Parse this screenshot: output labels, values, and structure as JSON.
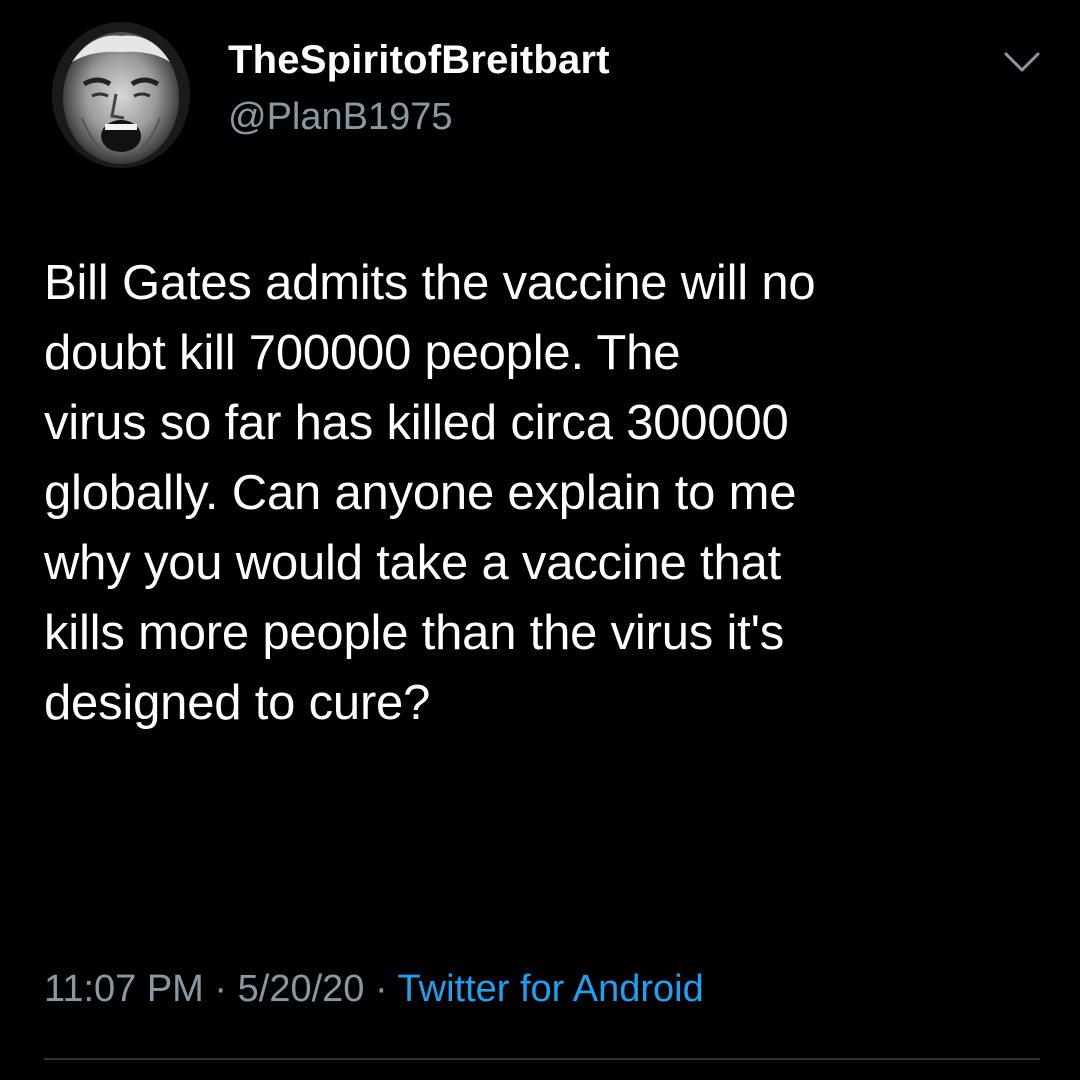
{
  "user": {
    "display_name": "TheSpiritofBreitbart",
    "handle": "@PlanB1975",
    "avatar_icon": "shouting-face-avatar"
  },
  "tweet": {
    "text": "Bill Gates admits the vaccine will no\ndoubt kill 700000 people. The\nvirus so far has killed circa 300000\nglobally. Can anyone explain to me\nwhy you would take a vaccine that\nkills more people than the virus it's\ndesigned to cure?",
    "time": "11:07 PM",
    "date": "5/20/20",
    "separator": "·",
    "source": "Twitter for Android"
  },
  "icons": {
    "menu": "chevron-down-icon"
  },
  "colors": {
    "background": "#000000",
    "text": "#ffffff",
    "muted": "#8899a6",
    "link": "#1da1f2",
    "divider": "#2f3336"
  }
}
